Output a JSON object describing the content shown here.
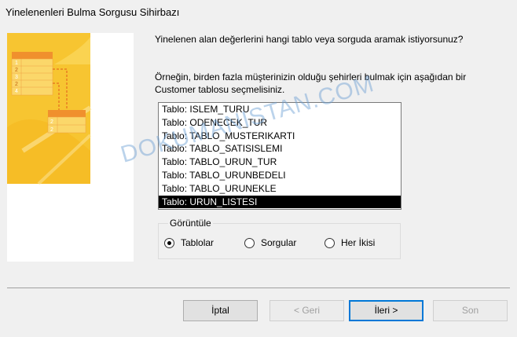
{
  "window": {
    "title": "Yinelenenleri Bulma Sorgusu Sihirbazı"
  },
  "prompt": {
    "question": "Yinelenen alan değerlerini hangi tablo veya sorguda aramak istiyorsunuz?",
    "example_line1": "Örneğin, birden fazla müşterinizin olduğu şehirleri bulmak için aşağıdan bir",
    "example_line2": "Customer tablosu seçmelisiniz."
  },
  "list": {
    "items": [
      "Tablo: ISLEM_TURU",
      "Tablo: ODENECEK_TUR",
      "Tablo: TABLO_MUSTERIKARTI",
      "Tablo: TABLO_SATISISLEMI",
      "Tablo: TABLO_URUN_TUR",
      "Tablo: TABLO_URUNBEDELI",
      "Tablo: TABLO_URUNEKLE",
      "Tablo: URUN_LISTESI"
    ],
    "selected_index": 7
  },
  "view_group": {
    "legend": "Görüntüle",
    "options": [
      "Tablolar",
      "Sorgular",
      "Her İkisi"
    ],
    "selected_index": 0
  },
  "buttons": {
    "cancel": "İptal",
    "back": "< Geri",
    "next": "İleri >",
    "finish": "Son"
  },
  "art": {
    "numbers_top": [
      "1",
      "2",
      "3",
      "2",
      "4"
    ],
    "numbers_bottom": [
      "2",
      "2"
    ]
  },
  "watermark": "DOKUMANISTAN.COM",
  "colors": {
    "art_yellow": "#f7c531",
    "art_orange": "#f0902d",
    "selection": "#000000",
    "default_button_border": "#0078d7"
  }
}
